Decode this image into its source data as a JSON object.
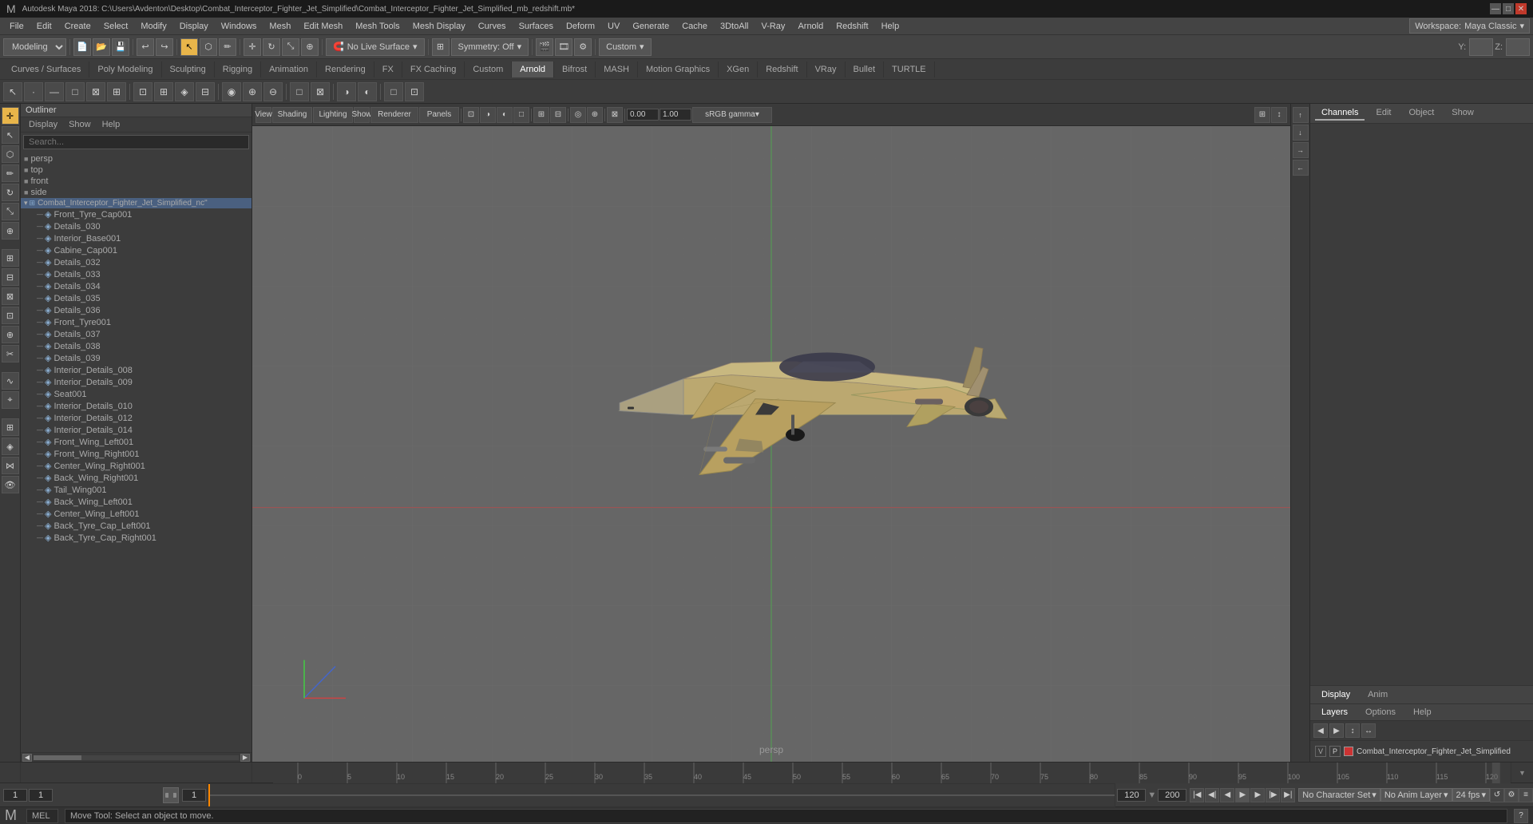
{
  "titlebar": {
    "title": "Autodesk Maya 2018: C:\\Users\\Avdenton\\Desktop\\Combat_Interceptor_Fighter_Jet_Simplified\\Combat_Interceptor_Fighter_Jet_Simplified_mb_redshift.mb*",
    "min_btn": "—",
    "max_btn": "□",
    "close_btn": "✕"
  },
  "menubar": {
    "items": [
      "File",
      "Edit",
      "Create",
      "Select",
      "Modify",
      "Display",
      "Windows",
      "Mesh",
      "Edit Mesh",
      "Mesh Tools",
      "Mesh Display",
      "Curves",
      "Surfaces",
      "Deform",
      "UV",
      "Generate",
      "Cache",
      "3DtoAll",
      "V-Ray",
      "Arnold",
      "Redshift",
      "Help"
    ],
    "workspace_label": "Workspace:",
    "workspace_value": "Maya Classic"
  },
  "main_toolbar": {
    "workspace_dropdown": "Modeling",
    "no_live_surface": "No Live Surface",
    "symmetry_off": "Symmetry: Off",
    "custom_label": "Custom",
    "y_label": "Y:",
    "z_label": "Z:"
  },
  "tabbar": {
    "tabs": [
      "Curves / Surfaces",
      "Poly Modeling",
      "Sculpting",
      "Rigging",
      "Animation",
      "Rendering",
      "FX",
      "FX Caching",
      "Custom",
      "Arnold",
      "Bifrost",
      "MASH",
      "Motion Graphics",
      "XGen",
      "Redshift",
      "VRay",
      "Bullet",
      "TURTLE"
    ]
  },
  "outliner": {
    "header": "Outliner",
    "menu_items": [
      "Display",
      "Show",
      "Help"
    ],
    "search_placeholder": "Search...",
    "tree_items": [
      {
        "label": "persp",
        "indent": 0,
        "type": "camera"
      },
      {
        "label": "top",
        "indent": 0,
        "type": "camera"
      },
      {
        "label": "front",
        "indent": 0,
        "type": "camera"
      },
      {
        "label": "side",
        "indent": 0,
        "type": "camera"
      },
      {
        "label": "Combat_Interceptor_Fighter_Jet_Simplified_nc\"",
        "indent": 0,
        "type": "group"
      },
      {
        "label": "Front_Tyre_Cap001",
        "indent": 2,
        "type": "mesh"
      },
      {
        "label": "Details_030",
        "indent": 2,
        "type": "mesh"
      },
      {
        "label": "Interior_Base001",
        "indent": 2,
        "type": "mesh"
      },
      {
        "label": "Cabine_Cap001",
        "indent": 2,
        "type": "mesh"
      },
      {
        "label": "Details_032",
        "indent": 2,
        "type": "mesh"
      },
      {
        "label": "Details_033",
        "indent": 2,
        "type": "mesh"
      },
      {
        "label": "Details_034",
        "indent": 2,
        "type": "mesh"
      },
      {
        "label": "Details_035",
        "indent": 2,
        "type": "mesh"
      },
      {
        "label": "Details_036",
        "indent": 2,
        "type": "mesh"
      },
      {
        "label": "Front_Tyre001",
        "indent": 2,
        "type": "mesh"
      },
      {
        "label": "Details_037",
        "indent": 2,
        "type": "mesh"
      },
      {
        "label": "Details_038",
        "indent": 2,
        "type": "mesh"
      },
      {
        "label": "Details_039",
        "indent": 2,
        "type": "mesh"
      },
      {
        "label": "Interior_Details_008",
        "indent": 2,
        "type": "mesh"
      },
      {
        "label": "Interior_Details_009",
        "indent": 2,
        "type": "mesh"
      },
      {
        "label": "Seat001",
        "indent": 2,
        "type": "mesh"
      },
      {
        "label": "Interior_Details_010",
        "indent": 2,
        "type": "mesh"
      },
      {
        "label": "Interior_Details_012",
        "indent": 2,
        "type": "mesh"
      },
      {
        "label": "Interior_Details_014",
        "indent": 2,
        "type": "mesh"
      },
      {
        "label": "Front_Wing_Left001",
        "indent": 2,
        "type": "mesh"
      },
      {
        "label": "Front_Wing_Right001",
        "indent": 2,
        "type": "mesh"
      },
      {
        "label": "Center_Wing_Right001",
        "indent": 2,
        "type": "mesh"
      },
      {
        "label": "Back_Wing_Right001",
        "indent": 2,
        "type": "mesh"
      },
      {
        "label": "Tail_Wing001",
        "indent": 2,
        "type": "mesh"
      },
      {
        "label": "Back_Wing_Left001",
        "indent": 2,
        "type": "mesh"
      },
      {
        "label": "Center_Wing_Left001",
        "indent": 2,
        "type": "mesh"
      },
      {
        "label": "Back_Tyre_Cap_Left001",
        "indent": 2,
        "type": "mesh"
      },
      {
        "label": "Back_Tyre_Cap_Right001",
        "indent": 2,
        "type": "mesh"
      }
    ]
  },
  "viewport": {
    "camera_label": "persp",
    "menu_items": [
      "View",
      "Shading",
      "Lighting",
      "Show",
      "Renderer",
      "Panels"
    ],
    "gamma_label": "sRGB gamma",
    "color_value": "0.00",
    "color_value2": "1.00"
  },
  "right_panel": {
    "tabs": [
      "Channels",
      "Edit",
      "Object",
      "Show"
    ],
    "display_tabs": [
      "Display",
      "Anim"
    ],
    "layer_tabs": [
      "Layers",
      "Options",
      "Help"
    ],
    "layer_name": "Combat_Interceptor_Fighter_Jet_Simplified",
    "v_label": "V",
    "p_label": "P"
  },
  "playback": {
    "start_frame": "1",
    "current_frame": "1",
    "range_start": "1",
    "range_end": "120",
    "end_frame": "120",
    "anim_end": "200",
    "no_character_set": "No Character Set",
    "no_anim_layer": "No Anim Layer",
    "fps_label": "24 fps"
  },
  "statusbar": {
    "mel_label": "MEL",
    "status_text": "Move Tool: Select an object to move."
  },
  "timeline": {
    "ticks": [
      "0",
      "5",
      "10",
      "15",
      "20",
      "25",
      "30",
      "35",
      "40",
      "45",
      "50",
      "55",
      "60",
      "65",
      "70",
      "75",
      "80",
      "85",
      "90",
      "95",
      "100",
      "105",
      "110",
      "115",
      "120"
    ]
  },
  "icons": {
    "chevron_down": "▾",
    "expand": "▸",
    "collapse": "▾",
    "camera": "📷",
    "mesh": "◈",
    "group": "⊞",
    "play": "▶",
    "stop": "■",
    "prev": "◀",
    "next": "▶",
    "rewind": "◀◀",
    "fastforward": "▶▶",
    "key": "◆",
    "search": "🔍"
  }
}
